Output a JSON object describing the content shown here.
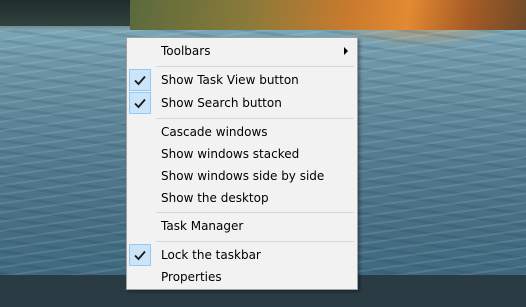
{
  "context_menu": {
    "items": [
      {
        "label": "Toolbars",
        "has_submenu": true
      },
      {
        "label": "Show Task View button",
        "checked": true
      },
      {
        "label": "Show Search button",
        "checked": true
      },
      {
        "label": "Cascade windows"
      },
      {
        "label": "Show windows stacked"
      },
      {
        "label": "Show windows side by side"
      },
      {
        "label": "Show the desktop"
      },
      {
        "label": "Task Manager"
      },
      {
        "label": "Lock the taskbar",
        "checked": true
      },
      {
        "label": "Properties"
      }
    ],
    "check_icon": "checkmark-icon",
    "submenu_icon": "chevron-right-icon",
    "colors": {
      "menu_background": "#f2f2f2",
      "check_highlight": "#cce4f7",
      "check_border": "#90c8f6",
      "check_mark": "#1a1a1a"
    }
  }
}
